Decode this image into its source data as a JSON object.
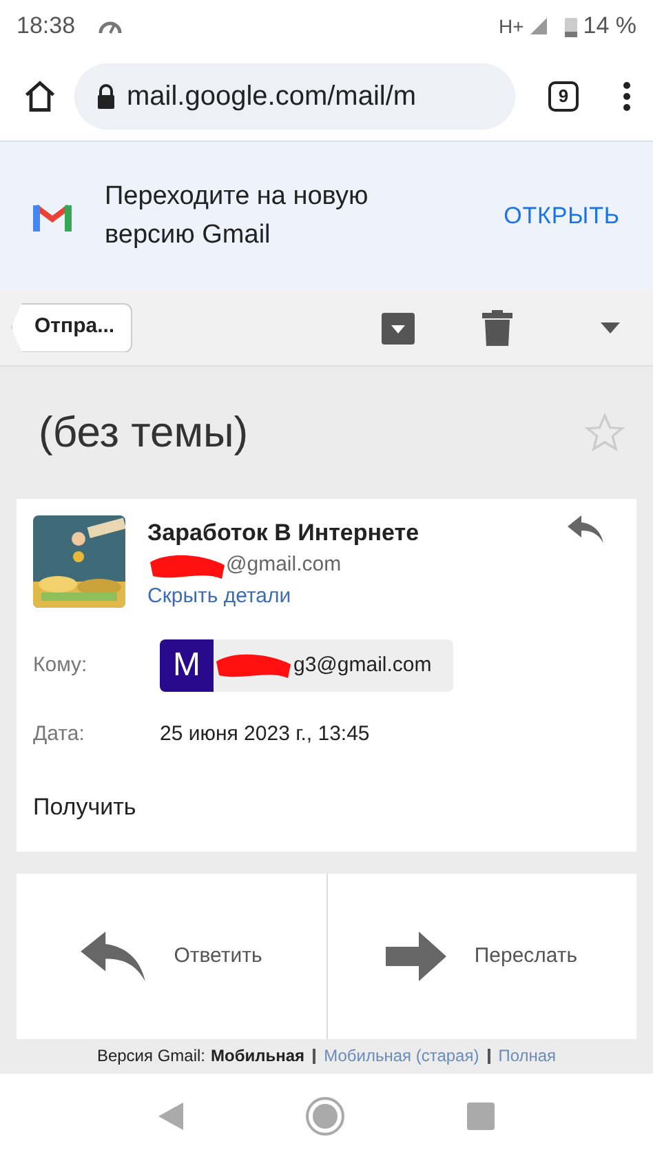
{
  "status_bar": {
    "time": "18:38",
    "network": "H+",
    "battery": "14 %"
  },
  "browser": {
    "url": "mail.google.com/mail/m",
    "tab_count": "9"
  },
  "banner": {
    "text": "Переходите на новую версию Gmail",
    "action": "ОТКРЫТЬ"
  },
  "toolbar": {
    "back_label": "Отпра..."
  },
  "message": {
    "subject": "(без темы)",
    "starred": false,
    "sender_name": "Заработок В Интернете",
    "sender_email_visible": "@gmail.com",
    "hide_details": "Скрыть детали",
    "to_label": "Кому:",
    "to_avatar_letter": "M",
    "to_email_visible": "g3@gmail.com",
    "date_label": "Дата:",
    "date": "25 июня 2023 г., 13:45",
    "body": "Получить"
  },
  "actions": [
    {
      "kind": "reply",
      "label": "Ответить"
    },
    {
      "kind": "forward",
      "label": "Переслать"
    }
  ],
  "footer": {
    "label": "Версия Gmail:",
    "current": "Мобильная",
    "links": [
      "Мобильная (старая)",
      "Полная"
    ]
  }
}
